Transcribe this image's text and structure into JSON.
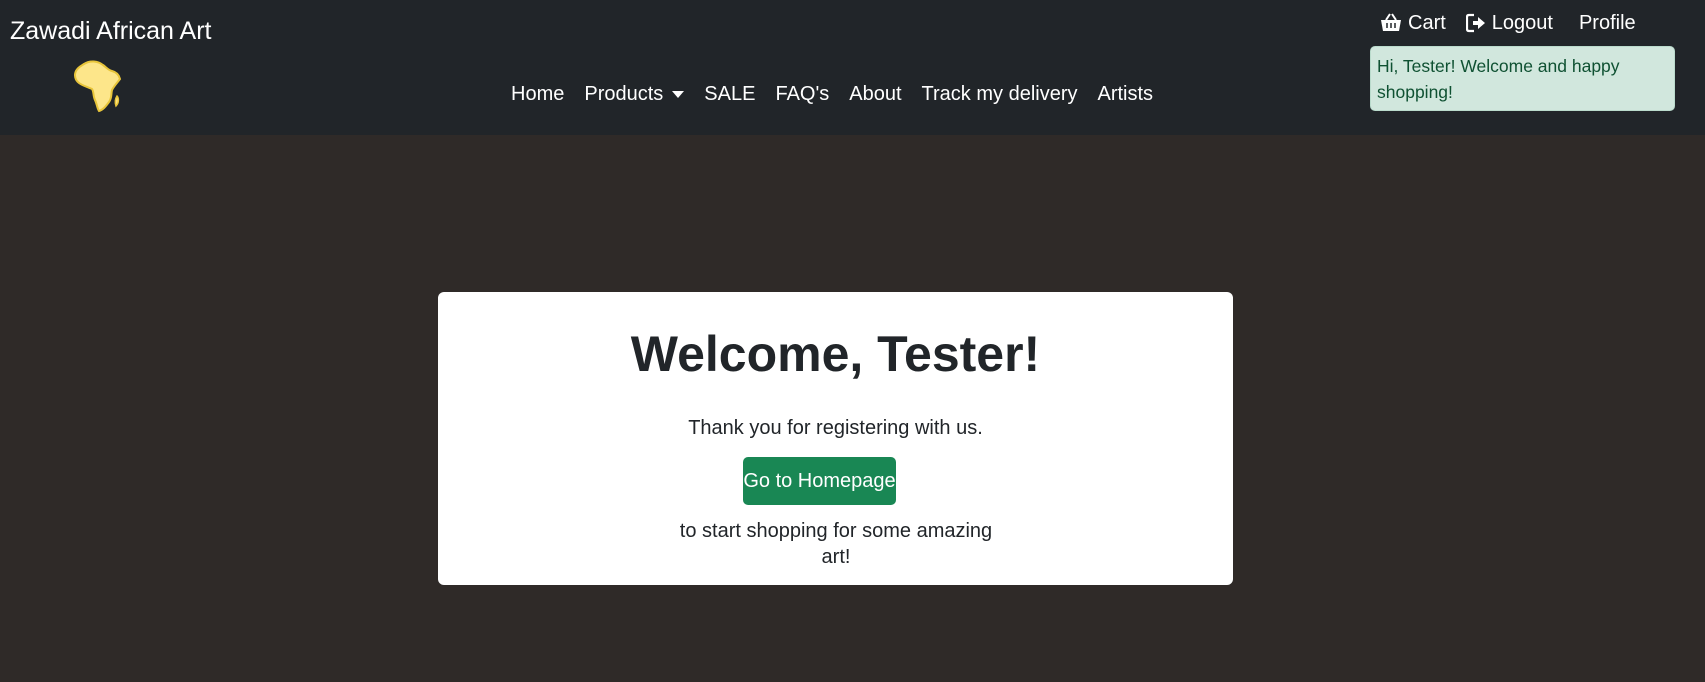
{
  "brand": {
    "name": "Zawadi African Art",
    "logo_icon": "africa-map-icon",
    "logo_color": "#fde68a"
  },
  "nav": {
    "items": [
      {
        "label": "Home"
      },
      {
        "label": "Products",
        "dropdown": true
      },
      {
        "label": "SALE"
      },
      {
        "label": "FAQ's"
      },
      {
        "label": "About"
      },
      {
        "label": "Track my delivery"
      },
      {
        "label": "Artists"
      }
    ]
  },
  "top_links": {
    "cart": {
      "label": "Cart",
      "icon": "basket-icon"
    },
    "logout": {
      "label": "Logout",
      "icon": "sign-out-icon"
    },
    "profile": {
      "label": "Profile"
    }
  },
  "greeting": {
    "text": "Hi, Tester! Welcome and happy shopping!"
  },
  "card": {
    "title": "Welcome, Tester!",
    "line1": "Thank you for registering with us.",
    "button_label": "Go to Homepage",
    "button_color": "#198754",
    "line2": "to start shopping for some amazing art!"
  },
  "colors": {
    "navbar_bg": "#212529",
    "page_bg": "#2f2a28",
    "greeting_bg": "#d1e7dd"
  }
}
